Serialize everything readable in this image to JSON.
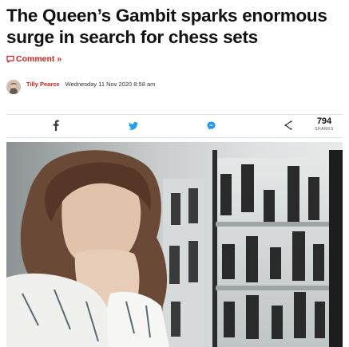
{
  "article": {
    "headline": "The Queen’s Gambit sparks enormous surge in search for chess sets",
    "comment_label": "Comment »",
    "author": "Tilly Pearce",
    "date": "Wednesday 11 Nov 2020 8:58 am"
  },
  "share": {
    "count": "794",
    "count_label": "SHARES",
    "icons": [
      "facebook-icon",
      "twitter-icon",
      "messenger-icon",
      "share-icon"
    ]
  },
  "colors": {
    "brand_red": "#d4201b",
    "twitter_blue": "#1da1f2",
    "messenger_blue": "#2196f3"
  }
}
